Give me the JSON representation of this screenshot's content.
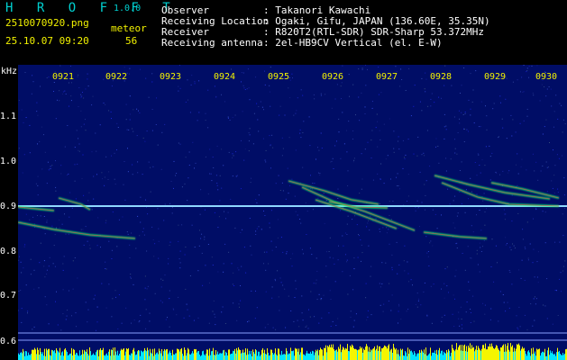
{
  "header": {
    "app_name": "H R O F F T",
    "version": "1.0.0",
    "filename": "2510070920.png",
    "datetime": "25.10.07 09:20",
    "meteor_label": "meteor",
    "meteor_count": "56",
    "info_keys": [
      "Observer",
      "Receiving Location",
      "Receiver",
      "Receiving antenna"
    ],
    "info_values": [
      ": Takanori Kawachi",
      ": Ogaki, Gifu, JAPAN (136.60E, 35.35N)",
      ": R820T2(RTL-SDR) SDR-Sharp 53.372MHz",
      ": 2el-HB9CV Vertical (el. E-W)"
    ]
  },
  "spectrogram": {
    "y_unit": "kHz",
    "y_ticks": [
      "1.1",
      "1.0",
      "0.9",
      "0.8",
      "0.7",
      "0.6"
    ],
    "x_ticks": [
      "0921",
      "0922",
      "0923",
      "0924",
      "0925",
      "0926",
      "0927",
      "0928",
      "0929",
      "0930"
    ],
    "colors": {
      "background": "#000d66",
      "carrier": "#8fd8ff",
      "trace": "#00ff66",
      "trace_core": "#ff3050",
      "level_low": "#00e5ff",
      "level_high": "#f5f500"
    }
  }
}
